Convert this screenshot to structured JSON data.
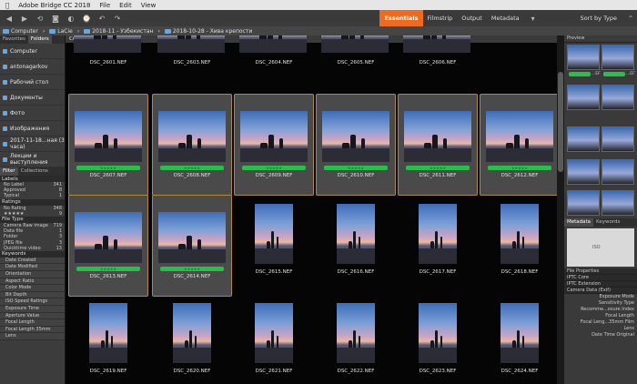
{
  "menubar": {
    "app": "Adobe Bridge CC 2018",
    "items": [
      "File",
      "Edit",
      "View"
    ]
  },
  "toolbar": {
    "workspaces": [
      "Essentials",
      "Filmstrip",
      "Output",
      "Metadata"
    ],
    "sort": "Sort by Type"
  },
  "path": [
    "Computer",
    "LaCie",
    "2018-11 - Узбекистан",
    "2018-10-28 - Хива крепости"
  ],
  "left": {
    "tabs": [
      "Favorites",
      "Folders"
    ],
    "favorites": [
      "Computer",
      "antonagarkov",
      "Рабочий стол",
      "Документы",
      "Фото",
      "Изображения",
      "2017-11-18...ная (3 часа)",
      "Лекции и выступления"
    ],
    "filter_tabs": [
      "Filter",
      "Collections"
    ],
    "labels_header": "Labels",
    "labels": [
      {
        "name": "No Label",
        "count": "341"
      },
      {
        "name": "Approved",
        "count": "8"
      },
      {
        "name": "Typical",
        "count": "1"
      }
    ],
    "ratings_header": "Ratings",
    "ratings": [
      {
        "name": "No Rating",
        "count": "348"
      },
      {
        "name": "★★★★★",
        "count": "9"
      }
    ],
    "filetype_header": "File Type",
    "filetypes": [
      {
        "name": "Camera Raw image",
        "count": "719"
      },
      {
        "name": "Data file",
        "count": "1"
      },
      {
        "name": "Folder",
        "count": "3"
      },
      {
        "name": "JPEG file",
        "count": "3"
      },
      {
        "name": "Quicktime video",
        "count": "13"
      }
    ],
    "keywords_header": "Keywords",
    "keywords": [
      "Date Created",
      "Date Modified",
      "Orientation",
      "Aspect Ratio",
      "Color Mode",
      "Bit Depth",
      "ISO Speed Ratings",
      "Exposure Time",
      "Aperture Value",
      "Focal Length",
      "Focal Length 35mm",
      "Lens"
    ]
  },
  "content": {
    "tab": "Content",
    "items": [
      {
        "name": "DSC_2601.NEF",
        "sel": false,
        "starred": false,
        "orient": "land"
      },
      {
        "name": "DSC_2603.NEF",
        "sel": false,
        "starred": false,
        "orient": "land"
      },
      {
        "name": "DSC_2604.NEF",
        "sel": false,
        "starred": false,
        "orient": "land"
      },
      {
        "name": "DSC_2605.NEF",
        "sel": false,
        "starred": false,
        "orient": "land"
      },
      {
        "name": "DSC_2606.NEF",
        "sel": false,
        "starred": false,
        "orient": "land"
      },
      {
        "name": "DSC_2607.NEF",
        "sel": true,
        "starred": true,
        "orient": "land"
      },
      {
        "name": "DSC_2608.NEF",
        "sel": true,
        "starred": true,
        "orient": "land"
      },
      {
        "name": "DSC_2609.NEF",
        "sel": true,
        "starred": true,
        "orient": "land"
      },
      {
        "name": "DSC_2610.NEF",
        "sel": true,
        "starred": true,
        "orient": "land"
      },
      {
        "name": "DSC_2611.NEF",
        "sel": true,
        "starred": true,
        "orient": "land"
      },
      {
        "name": "DSC_2612.NEF",
        "sel": true,
        "starred": true,
        "orient": "land"
      },
      {
        "name": "DSC_2613.NEF",
        "sel": true,
        "starred": true,
        "orient": "land"
      },
      {
        "name": "DSC_2614.NEF",
        "sel": true,
        "starred": true,
        "orient": "land"
      },
      {
        "name": "DSC_2615.NEF",
        "sel": false,
        "starred": false,
        "orient": "port"
      },
      {
        "name": "DSC_2616.NEF",
        "sel": false,
        "starred": false,
        "orient": "port"
      },
      {
        "name": "DSC_2617.NEF",
        "sel": false,
        "starred": false,
        "orient": "port"
      },
      {
        "name": "DSC_2618.NEF",
        "sel": false,
        "starred": false,
        "orient": "port"
      },
      {
        "name": "DSC_2619.NEF",
        "sel": false,
        "starred": false,
        "orient": "port"
      },
      {
        "name": "DSC_2620.NEF",
        "sel": false,
        "starred": false,
        "orient": "port"
      },
      {
        "name": "DSC_2621.NEF",
        "sel": false,
        "starred": false,
        "orient": "port"
      },
      {
        "name": "DSC_2622.NEF",
        "sel": false,
        "starred": false,
        "orient": "port"
      },
      {
        "name": "DSC_2623.NEF",
        "sel": false,
        "starred": false,
        "orient": "port"
      },
      {
        "name": "DSC_2624.NEF",
        "sel": false,
        "starred": false,
        "orient": "port"
      }
    ],
    "stars_text": "★★★★★"
  },
  "right": {
    "tab": "Preview",
    "strip_labels": [
      "...EF",
      "...EF"
    ],
    "metadata_tabs": [
      "Metadata",
      "Keywords"
    ],
    "iso": "ISO",
    "sections": [
      "File Properties",
      "IPTC Core",
      "IPTC Extension",
      "Camera Data (Exif)"
    ],
    "exif": [
      "Exposure Mode",
      "Sensitivity Type",
      "Recomme...osure Index",
      "Focal Length",
      "Focal Leng...35mm Film",
      "Lens",
      "Date Time Original"
    ]
  },
  "colors": {
    "accent": "#ee6a1c",
    "select_border": "#b08a3a",
    "rating_green": "#27c14a"
  }
}
